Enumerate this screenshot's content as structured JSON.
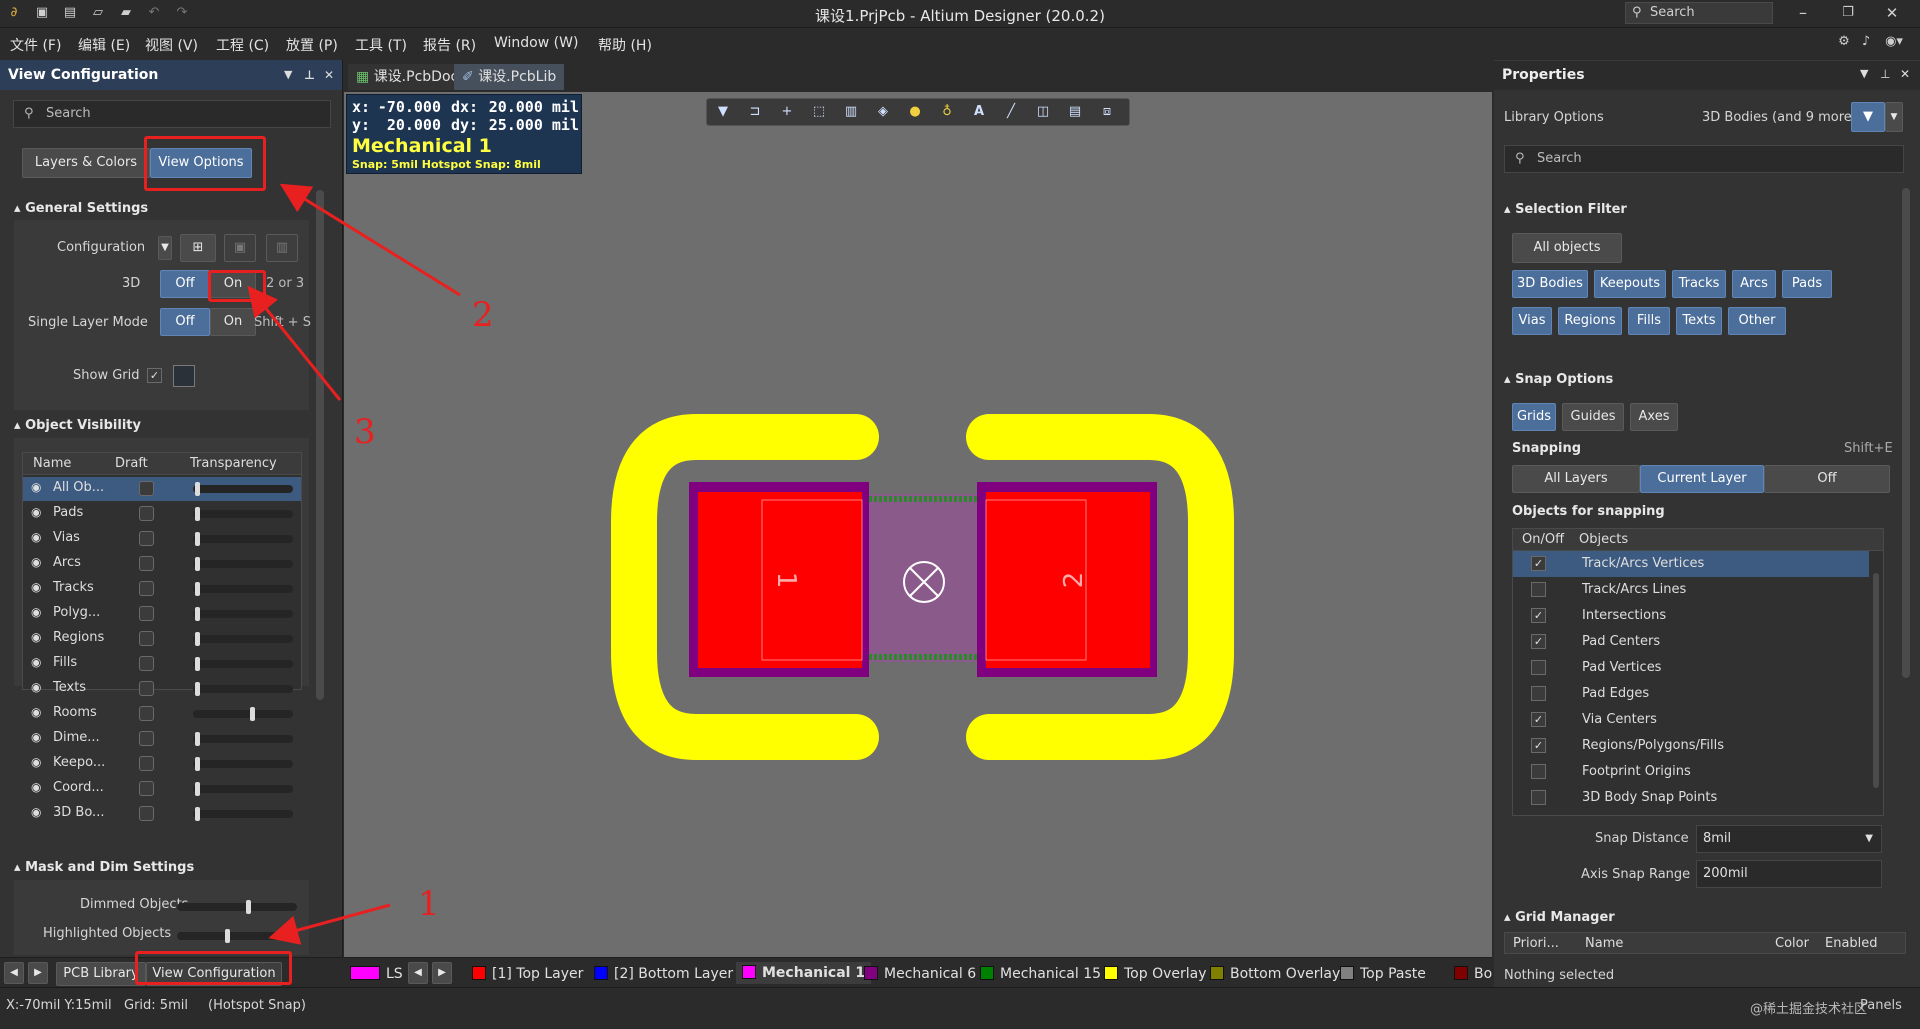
{
  "titlebar": {
    "title": "课设1.PrjPcb - Altium Designer (20.0.2)",
    "search_placeholder": "Search"
  },
  "menu": [
    "文件 (F)",
    "编辑 (E)",
    "视图 (V)",
    "工程 (C)",
    "放置 (P)",
    "工具 (T)",
    "报告 (R)",
    "Window (W)",
    "帮助 (H)"
  ],
  "left_panel": {
    "title": "View Configuration",
    "search_placeholder": "Search",
    "tabs": [
      "Layers & Colors",
      "View Options"
    ],
    "general_settings": "General Settings",
    "configuration_label": "Configuration",
    "label_3d": "3D",
    "single_layer_label": "Single Layer Mode",
    "off": "Off",
    "on": "On",
    "hint_3d": "2 or 3",
    "hint_single": "Shift + S",
    "show_grid": "Show Grid",
    "object_visibility": "Object Visibility",
    "columns": [
      "Name",
      "Draft",
      "Transparency"
    ],
    "objects": [
      {
        "name": "All Ob...",
        "transparency": 0.02
      },
      {
        "name": "Pads",
        "transparency": 0.02
      },
      {
        "name": "Vias",
        "transparency": 0.02
      },
      {
        "name": "Arcs",
        "transparency": 0.02
      },
      {
        "name": "Tracks",
        "transparency": 0.02
      },
      {
        "name": "Polyg...",
        "transparency": 0.02
      },
      {
        "name": "Regions",
        "transparency": 0.02
      },
      {
        "name": "Fills",
        "transparency": 0.02
      },
      {
        "name": "Texts",
        "transparency": 0.02
      },
      {
        "name": "Rooms",
        "transparency": 0.6
      },
      {
        "name": "Dime...",
        "transparency": 0.02
      },
      {
        "name": "Keepo...",
        "transparency": 0.02
      },
      {
        "name": "Coord...",
        "transparency": 0.02
      },
      {
        "name": "3D Bo...",
        "transparency": 0.02
      }
    ],
    "mask_dim": "Mask and Dim Settings",
    "dimmed_objects": "Dimmed Objects",
    "highlighted_objects": "Highlighted Objects",
    "dimmed_level": 0.6,
    "highlighted_level": 0.42,
    "bottom_tabs": [
      "PCB Library",
      "View Configuration"
    ]
  },
  "doc_tabs": [
    "课设.PcbDoc",
    "课设.PcbLib"
  ],
  "coords": {
    "x_label": "x:",
    "x": "-70.000",
    "dx_label": "dx:",
    "dx": "20.000 mil",
    "y_label": "y:",
    "y": "20.000",
    "dy_label": "dy:",
    "dy": "25.000 mil",
    "layer": "Mechanical 1",
    "snap": "Snap: 5mil Hotspot Snap: 8mil"
  },
  "pads": {
    "pad1": "1",
    "pad2": "2"
  },
  "right_panel": {
    "title": "Properties",
    "library_options": "Library Options",
    "filter_summary": "3D Bodies (and 9 more)",
    "search_placeholder": "Search",
    "selection_filter": "Selection Filter",
    "all_objects": "All objects",
    "filters_row1": [
      "3D Bodies",
      "Keepouts",
      "Tracks",
      "Arcs",
      "Pads"
    ],
    "filters_row2": [
      "Vias",
      "Regions",
      "Fills",
      "Texts",
      "Other"
    ],
    "snap_options": "Snap Options",
    "snap_buttons": [
      "Grids",
      "Guides",
      "Axes"
    ],
    "snapping": "Snapping",
    "snapping_shortcut": "Shift+E",
    "snapping_modes": [
      "All Layers",
      "Current Layer",
      "Off"
    ],
    "objects_for_snapping": "Objects for snapping",
    "snap_columns": [
      "On/Off",
      "Objects"
    ],
    "snap_objects": [
      {
        "name": "Track/Arcs Vertices",
        "on": true
      },
      {
        "name": "Track/Arcs Lines",
        "on": false
      },
      {
        "name": "Intersections",
        "on": true
      },
      {
        "name": "Pad Centers",
        "on": true
      },
      {
        "name": "Pad Vertices",
        "on": false
      },
      {
        "name": "Pad Edges",
        "on": false
      },
      {
        "name": "Via Centers",
        "on": true
      },
      {
        "name": "Regions/Polygons/Fills",
        "on": true
      },
      {
        "name": "Footprint Origins",
        "on": false
      },
      {
        "name": "3D Body Snap Points",
        "on": false
      }
    ],
    "snap_distance_label": "Snap Distance",
    "snap_distance": "8mil",
    "axis_snap_label": "Axis Snap Range",
    "axis_snap": "200mil",
    "grid_manager": "Grid Manager",
    "grid_columns": [
      "Priori...",
      "Name",
      "Color",
      "Enabled"
    ],
    "nothing_selected": "Nothing selected"
  },
  "layers": [
    {
      "label": "LS",
      "color": "#ff00ff"
    },
    {
      "label": "[1] Top Layer",
      "color": "#ff0000"
    },
    {
      "label": "[2] Bottom Layer",
      "color": "#0000ff"
    },
    {
      "label": "Mechanical 1",
      "color": "#ff00ff"
    },
    {
      "label": "Mechanical 6",
      "color": "#800080"
    },
    {
      "label": "Mechanical 15",
      "color": "#008000"
    },
    {
      "label": "Top Overlay",
      "color": "#ffff00"
    },
    {
      "label": "Bottom Overlay",
      "color": "#808000"
    },
    {
      "label": "Top Paste",
      "color": "#808080"
    },
    {
      "label": "Bo",
      "color": "#800000"
    }
  ],
  "status": {
    "coords": "X:-70mil Y:15mil",
    "grid": "Grid: 5mil",
    "hotspot": "(Hotspot Snap)",
    "panels": "Panels",
    "watermark": "@稀土掘金技术社区"
  },
  "annotations": [
    "1",
    "2",
    "3"
  ],
  "colors": {
    "accent": "#4b6e9a",
    "annotation": "#e82020",
    "overlay": "#ffff00",
    "pad": "#ff0000"
  }
}
